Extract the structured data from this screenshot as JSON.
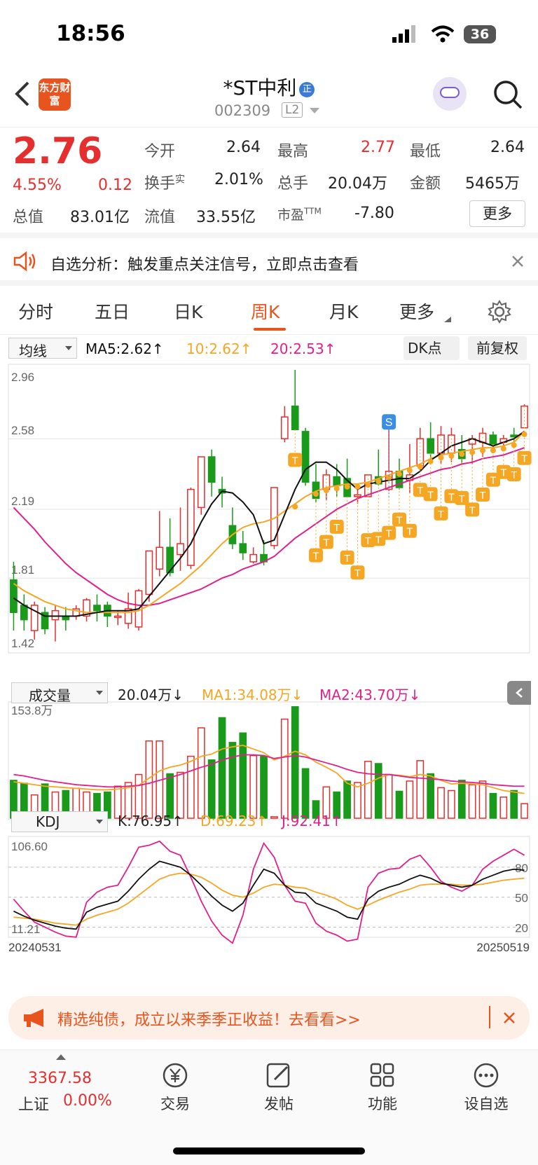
{
  "status": {
    "time": "18:56",
    "battery": "36"
  },
  "header": {
    "logo": "东方财富",
    "name": "*ST中利",
    "badge": "正",
    "code": "002309",
    "level": "L2"
  },
  "quote": {
    "price": "2.76",
    "change_pct": "4.55%",
    "change": "0.12",
    "open_label": "今开",
    "open": "2.64",
    "high_label": "最高",
    "high": "2.77",
    "low_label": "最低",
    "low": "2.64",
    "turnover_label": "换手",
    "turnover_sup": "实",
    "turnover": "2.01%",
    "volume_label": "总手",
    "volume": "20.04万",
    "amount_label": "金额",
    "amount": "5465万",
    "mktcap_label": "总值",
    "mktcap": "83.01亿",
    "float_label": "流值",
    "float": "33.55亿",
    "pe_label": "市盈",
    "pe_sup": "TTM",
    "pe": "-7.80",
    "more": "更多"
  },
  "alert": {
    "text": "自选分析：触发重点关注信号，立即点击查看"
  },
  "tabs": {
    "t1": "分时",
    "t2": "五日",
    "t3": "日K",
    "t4": "周K",
    "t5": "月K",
    "t6": "更多"
  },
  "kline": {
    "indicator": "均线",
    "ma5": "MA5:2.62↑",
    "ma10": "10:2.62↑",
    "ma20": "20:2.53↑",
    "dk": "DK点",
    "adjust": "前复权",
    "y1": "2.96",
    "y2": "2.58",
    "y3": "2.19",
    "y4": "1.81",
    "y5": "1.42",
    "s_marker": "S",
    "t_marker": "T"
  },
  "volume": {
    "indicator": "成交量",
    "value": "20.04万↓",
    "ma1": "MA1:34.08万↓",
    "ma2": "MA2:43.70万↓",
    "ymax": "153.8万"
  },
  "kdj": {
    "indicator": "KDJ",
    "k": "K:76.95↑",
    "d": "D:69.23↑",
    "j": "J:92.41↑",
    "ymax": "106.60",
    "ymin": "11.21",
    "l80": "80",
    "l50": "50",
    "l20": "20",
    "start": "20240531",
    "end": "20250519"
  },
  "ad": {
    "text": "精选纯债，成立以来季季正收益！去看看>>"
  },
  "bottom": {
    "index_value": "3367.58",
    "index_name": "上证",
    "index_change": "0.00%",
    "trade": "交易",
    "post": "发帖",
    "func": "功能",
    "watch": "设自选"
  },
  "colors": {
    "up": "#e52e2e",
    "down": "#1a9a1a",
    "ma5": "#111111",
    "ma10": "#f5a623",
    "ma20": "#e0208c",
    "accent": "#e8541e"
  },
  "chart_data": {
    "type": "candlestick",
    "period": "weekly",
    "ylim": [
      1.42,
      2.96
    ],
    "candles": [
      {
        "o": 1.8,
        "h": 1.9,
        "l": 1.52,
        "c": 1.62
      },
      {
        "o": 1.66,
        "h": 1.72,
        "l": 1.52,
        "c": 1.58
      },
      {
        "o": 1.52,
        "h": 1.68,
        "l": 1.47,
        "c": 1.66
      },
      {
        "o": 1.62,
        "h": 1.65,
        "l": 1.5,
        "c": 1.53
      },
      {
        "o": 1.58,
        "h": 1.66,
        "l": 1.46,
        "c": 1.63
      },
      {
        "o": 1.6,
        "h": 1.65,
        "l": 1.52,
        "c": 1.58
      },
      {
        "o": 1.6,
        "h": 1.66,
        "l": 1.58,
        "c": 1.64
      },
      {
        "o": 1.6,
        "h": 1.7,
        "l": 1.57,
        "c": 1.69
      },
      {
        "o": 1.66,
        "h": 1.72,
        "l": 1.57,
        "c": 1.63
      },
      {
        "o": 1.66,
        "h": 1.68,
        "l": 1.54,
        "c": 1.6
      },
      {
        "o": 1.6,
        "h": 1.63,
        "l": 1.55,
        "c": 1.6
      },
      {
        "o": 1.56,
        "h": 1.73,
        "l": 1.53,
        "c": 1.64
      },
      {
        "o": 1.54,
        "h": 1.75,
        "l": 1.52,
        "c": 1.74
      },
      {
        "o": 1.72,
        "h": 1.96,
        "l": 1.68,
        "c": 1.96
      },
      {
        "o": 1.86,
        "h": 2.18,
        "l": 1.82,
        "c": 1.98
      },
      {
        "o": 1.98,
        "h": 2.14,
        "l": 1.82,
        "c": 1.84
      },
      {
        "o": 1.94,
        "h": 2.2,
        "l": 1.85,
        "c": 2.0
      },
      {
        "o": 1.88,
        "h": 2.31,
        "l": 1.86,
        "c": 2.3
      },
      {
        "o": 2.2,
        "h": 2.48,
        "l": 2.16,
        "c": 2.48
      },
      {
        "o": 2.48,
        "h": 2.52,
        "l": 2.26,
        "c": 2.34
      },
      {
        "o": 2.3,
        "h": 2.37,
        "l": 2.2,
        "c": 2.28
      },
      {
        "o": 2.1,
        "h": 2.2,
        "l": 1.97,
        "c": 2.0
      },
      {
        "o": 2.0,
        "h": 2.07,
        "l": 1.91,
        "c": 1.95
      },
      {
        "o": 1.9,
        "h": 1.98,
        "l": 1.89,
        "c": 1.94
      },
      {
        "o": 1.94,
        "h": 2.02,
        "l": 1.88,
        "c": 1.9
      },
      {
        "o": 1.99,
        "h": 2.31,
        "l": 1.97,
        "c": 2.31
      },
      {
        "o": 2.58,
        "h": 2.76,
        "l": 2.56,
        "c": 2.7
      },
      {
        "o": 2.76,
        "h": 2.96,
        "l": 2.64,
        "c": 2.63
      },
      {
        "o": 2.62,
        "h": 2.64,
        "l": 2.32,
        "c": 2.34
      },
      {
        "o": 2.34,
        "h": 2.44,
        "l": 2.23,
        "c": 2.25
      },
      {
        "o": 2.3,
        "h": 2.41,
        "l": 2.24,
        "c": 2.38
      },
      {
        "o": 2.37,
        "h": 2.44,
        "l": 2.26,
        "c": 2.32
      },
      {
        "o": 2.36,
        "h": 2.47,
        "l": 2.26,
        "c": 2.26
      },
      {
        "o": 2.26,
        "h": 2.3,
        "l": 2.22,
        "c": 2.27
      },
      {
        "o": 2.26,
        "h": 2.35,
        "l": 2.26,
        "c": 2.38
      },
      {
        "o": 2.37,
        "h": 2.52,
        "l": 2.32,
        "c": 2.33
      },
      {
        "o": 2.3,
        "h": 2.7,
        "l": 2.29,
        "c": 2.4
      },
      {
        "o": 2.4,
        "h": 2.47,
        "l": 2.3,
        "c": 2.31
      },
      {
        "o": 2.35,
        "h": 2.55,
        "l": 2.28,
        "c": 2.38
      },
      {
        "o": 2.43,
        "h": 2.64,
        "l": 2.4,
        "c": 2.58
      },
      {
        "o": 2.58,
        "h": 2.67,
        "l": 2.44,
        "c": 2.5
      },
      {
        "o": 2.5,
        "h": 2.65,
        "l": 2.44,
        "c": 2.6
      },
      {
        "o": 2.5,
        "h": 2.64,
        "l": 2.45,
        "c": 2.6
      },
      {
        "o": 2.52,
        "h": 2.6,
        "l": 2.44,
        "c": 2.47
      },
      {
        "o": 2.55,
        "h": 2.6,
        "l": 2.44,
        "c": 2.58
      },
      {
        "o": 2.56,
        "h": 2.64,
        "l": 2.48,
        "c": 2.61
      },
      {
        "o": 2.6,
        "h": 2.62,
        "l": 2.52,
        "c": 2.55
      },
      {
        "o": 2.56,
        "h": 2.6,
        "l": 2.52,
        "c": 2.58
      },
      {
        "o": 2.6,
        "h": 2.64,
        "l": 2.55,
        "c": 2.59
      },
      {
        "o": 2.64,
        "h": 2.77,
        "l": 2.64,
        "c": 2.76
      }
    ],
    "ma5": [
      1.7,
      1.66,
      1.63,
      1.6,
      1.6,
      1.6,
      1.6,
      1.61,
      1.62,
      1.63,
      1.63,
      1.63,
      1.64,
      1.71,
      1.78,
      1.85,
      1.92,
      2.0,
      2.12,
      2.22,
      2.29,
      2.28,
      2.23,
      2.16,
      2.0,
      2.02,
      2.16,
      2.3,
      2.41,
      2.45,
      2.45,
      2.41,
      2.35,
      2.3,
      2.33,
      2.34,
      2.35,
      2.36,
      2.36,
      2.4,
      2.46,
      2.5,
      2.54,
      2.56,
      2.58,
      2.56,
      2.54,
      2.56,
      2.58,
      2.62
    ],
    "ma10": [
      1.78,
      1.74,
      1.71,
      1.68,
      1.66,
      1.64,
      1.63,
      1.62,
      1.62,
      1.62,
      1.62,
      1.62,
      1.63,
      1.66,
      1.7,
      1.74,
      1.78,
      1.83,
      1.88,
      1.94,
      2.0,
      2.05,
      2.09,
      2.11,
      2.12,
      2.14,
      2.18,
      2.22,
      2.26,
      2.29,
      2.31,
      2.32,
      2.33,
      2.33,
      2.34,
      2.36,
      2.38,
      2.4,
      2.42,
      2.44,
      2.47,
      2.49,
      2.5,
      2.51,
      2.52,
      2.53,
      2.53,
      2.54,
      2.56,
      2.62
    ],
    "ma20": [
      2.2,
      2.14,
      2.08,
      2.01,
      1.95,
      1.89,
      1.84,
      1.8,
      1.76,
      1.72,
      1.69,
      1.67,
      1.66,
      1.66,
      1.67,
      1.69,
      1.71,
      1.73,
      1.75,
      1.78,
      1.81,
      1.83,
      1.86,
      1.88,
      1.9,
      1.93,
      1.98,
      2.03,
      2.07,
      2.11,
      2.15,
      2.19,
      2.22,
      2.25,
      2.27,
      2.29,
      2.31,
      2.33,
      2.35,
      2.37,
      2.39,
      2.41,
      2.42,
      2.44,
      2.45,
      2.47,
      2.48,
      2.49,
      2.51,
      2.53
    ],
    "volume": [
      52,
      48,
      32,
      47,
      36,
      38,
      41,
      36,
      34,
      36,
      44,
      49,
      60,
      106,
      106,
      61,
      63,
      85,
      124,
      80,
      138,
      104,
      117,
      86,
      85,
      2,
      136,
      153,
      68,
      24,
      43,
      36,
      51,
      49,
      78,
      75,
      60,
      37,
      51,
      79,
      61,
      42,
      38,
      52,
      46,
      51,
      34,
      29,
      38,
      20
    ],
    "vol_ma1": [
      50,
      48,
      46,
      44,
      43,
      42,
      41,
      40,
      39,
      39,
      40,
      42,
      45,
      55,
      65,
      70,
      73,
      78,
      85,
      88,
      95,
      98,
      100,
      95,
      90,
      80,
      85,
      92,
      87,
      77,
      70,
      62,
      48,
      43,
      48,
      55,
      60,
      59,
      57,
      60,
      58,
      52,
      47,
      48,
      47,
      46,
      42,
      38,
      36,
      34
    ],
    "vol_ma2": [
      60,
      58,
      55,
      52,
      50,
      48,
      46,
      45,
      44,
      43,
      43,
      44,
      45,
      48,
      52,
      56,
      60,
      65,
      70,
      74,
      80,
      84,
      87,
      87,
      86,
      82,
      84,
      86,
      84,
      80,
      76,
      72,
      67,
      63,
      61,
      60,
      60,
      58,
      56,
      55,
      54,
      53,
      51,
      50,
      49,
      48,
      46,
      45,
      44,
      44
    ],
    "kdj_k": [
      36,
      31,
      27,
      24,
      21,
      19,
      18,
      35,
      40,
      43,
      46,
      56,
      68,
      78,
      86,
      83,
      80,
      72,
      62,
      51,
      42,
      36,
      44,
      62,
      78,
      74,
      62,
      55,
      54,
      44,
      40,
      36,
      30,
      28,
      48,
      56,
      60,
      63,
      68,
      72,
      69,
      64,
      62,
      60,
      62,
      68,
      72,
      76,
      78,
      77
    ],
    "kdj_d": [
      30,
      29,
      28,
      26,
      24,
      23,
      22,
      28,
      32,
      35,
      38,
      44,
      52,
      60,
      68,
      72,
      74,
      73,
      70,
      64,
      57,
      52,
      50,
      54,
      60,
      63,
      62,
      60,
      59,
      55,
      52,
      48,
      42,
      38,
      42,
      47,
      51,
      55,
      58,
      62,
      63,
      63,
      63,
      62,
      62,
      63,
      65,
      67,
      68,
      69
    ],
    "kdj_j": [
      48,
      36,
      25,
      20,
      15,
      11,
      10,
      45,
      55,
      60,
      62,
      80,
      100,
      102,
      106,
      96,
      92,
      70,
      46,
      26,
      12,
      4,
      32,
      78,
      104,
      90,
      62,
      46,
      44,
      24,
      16,
      12,
      6,
      8,
      60,
      74,
      78,
      79,
      88,
      92,
      80,
      66,
      60,
      56,
      62,
      78,
      86,
      92,
      98,
      92
    ],
    "signals": [
      {
        "i": 36,
        "type": "S"
      }
    ]
  }
}
